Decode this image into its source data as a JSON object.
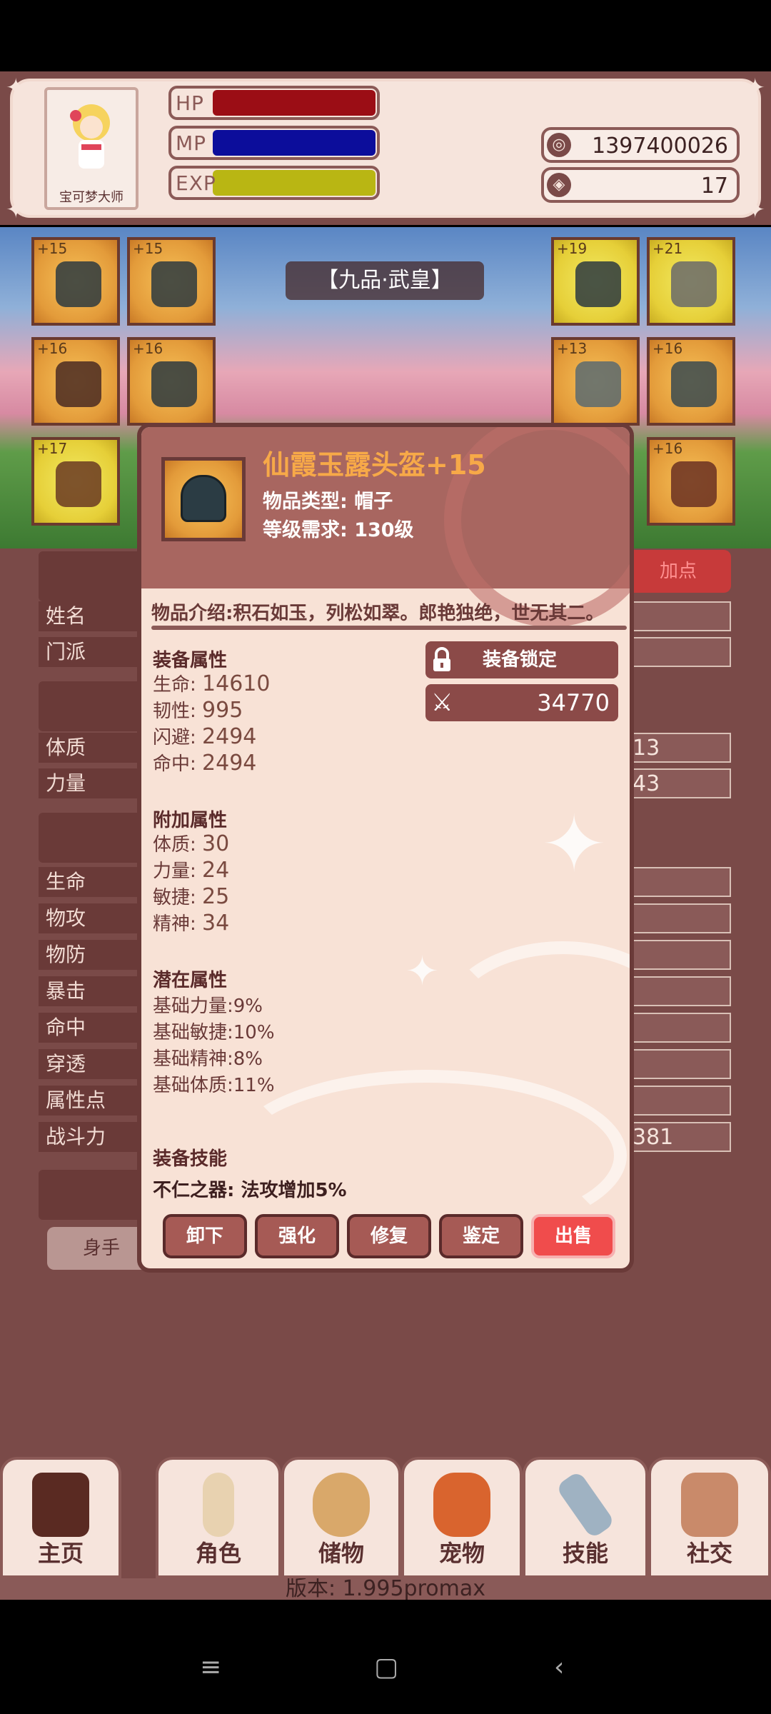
{
  "player": {
    "name": "宝可梦大师",
    "hp_label": "HP",
    "mp_label": "MP",
    "exp_label": "EXP",
    "hp_fill": 1.0,
    "mp_fill": 1.0,
    "exp_fill": 1.0,
    "gold": "1397400026",
    "gems": "17"
  },
  "colors": {
    "hp": "#9b0d15",
    "mp": "#0c0d9b",
    "exp": "#b9b613",
    "sell": "#f04c4c",
    "title_orange": "#f7a948"
  },
  "scene": {
    "realm": "【九品·武皇】",
    "left_slots": [
      "+15",
      "+15",
      "+16",
      "+16",
      "+17"
    ],
    "right_slots": [
      "+19",
      "+21",
      "+13",
      "+16",
      "+16"
    ]
  },
  "panel": {
    "add_point_label": "加点",
    "rows_a": [
      {
        "label": "姓名",
        "value": ""
      },
      {
        "label": "门派",
        "value": ""
      }
    ],
    "rows_b": [
      {
        "label": "体质",
        "value": "13"
      },
      {
        "label": "力量",
        "value": "43"
      }
    ],
    "rows_c": [
      {
        "label": "生命",
        "value": ""
      },
      {
        "label": "物攻",
        "value": ""
      },
      {
        "label": "物防",
        "value": ""
      },
      {
        "label": "暴击",
        "value": ""
      },
      {
        "label": "命中",
        "value": ""
      },
      {
        "label": "穿透",
        "value": ""
      },
      {
        "label": "属性点",
        "value": ""
      },
      {
        "label": "战斗力",
        "value": "381"
      }
    ],
    "partial_button": "身手"
  },
  "dialog": {
    "title": "仙霞玉露头盔+15",
    "item_type": "物品类型: 帽子",
    "level_req": "等级需求: 130级",
    "intro": "物品介绍:积石如玉，列松如翠。郎艳独绝，世无其二。",
    "lock_label": "装备锁定",
    "power": "34770",
    "base_title": "装备属性",
    "base_stats": [
      {
        "name": "生命:",
        "value": "14610"
      },
      {
        "name": "韧性:",
        "value": "995"
      },
      {
        "name": "闪避:",
        "value": "2494"
      },
      {
        "name": "命中:",
        "value": "2494"
      }
    ],
    "extra_title": "附加属性",
    "extra_stats": [
      {
        "name": "体质:",
        "value": "30"
      },
      {
        "name": "力量:",
        "value": "24"
      },
      {
        "name": "敏捷:",
        "value": "25"
      },
      {
        "name": "精神:",
        "value": "34"
      }
    ],
    "latent_title": "潜在属性",
    "latent_stats": [
      "基础力量:9%",
      "基础敏捷:10%",
      "基础精神:8%",
      "基础体质:11%"
    ],
    "skill_title": "装备技能",
    "skill_text": "不仁之器: 法攻增加5%",
    "buttons": [
      "卸下",
      "强化",
      "修复",
      "鉴定",
      "出售"
    ]
  },
  "nav": {
    "items": [
      "主页",
      "角色",
      "储物",
      "宠物",
      "技能",
      "社交"
    ],
    "version": "版本: 1.995promax"
  },
  "icons": {
    "gold": "coin-icon",
    "gem": "gem-icon",
    "lock": "lock-icon",
    "power": "crossed-swords-icon"
  }
}
